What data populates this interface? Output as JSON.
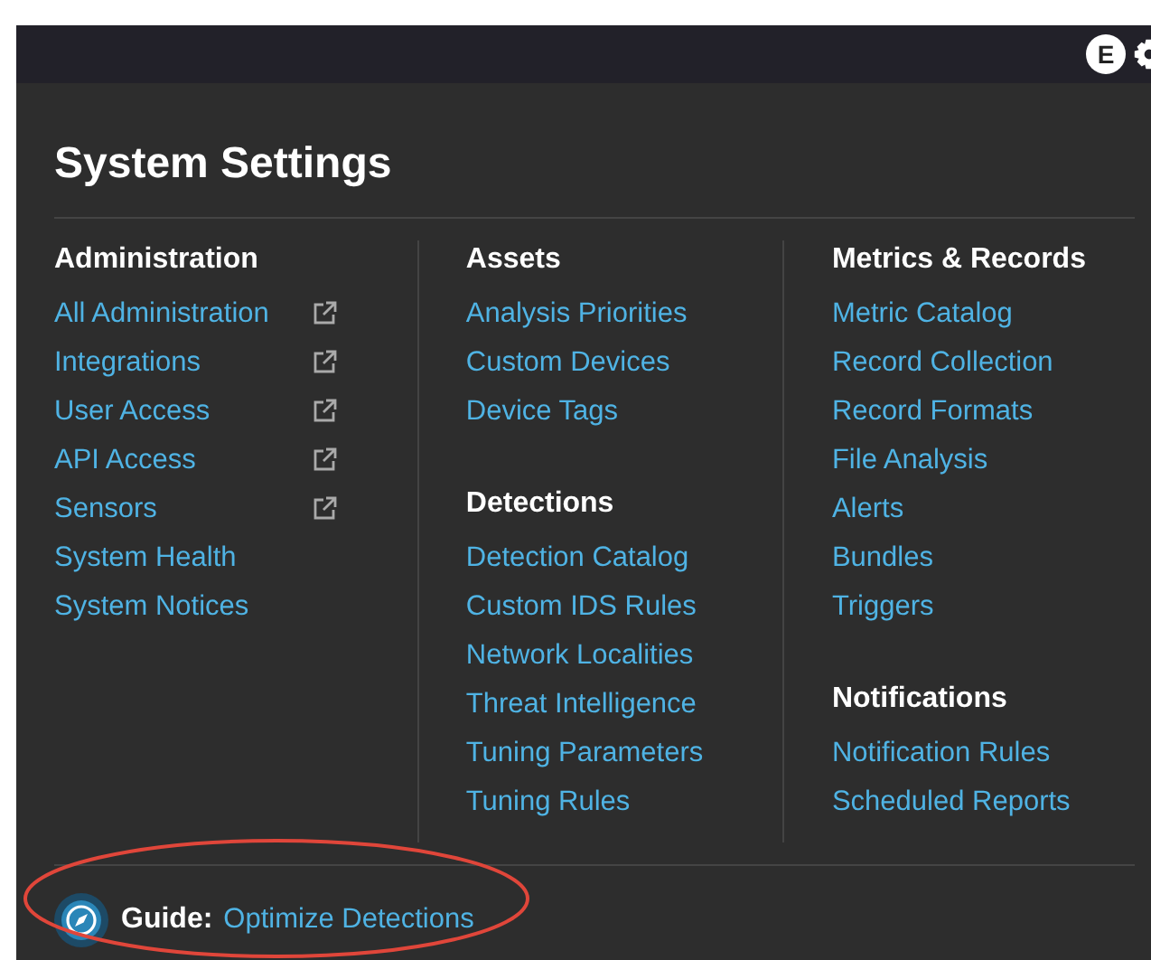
{
  "top_bar": {
    "avatar_letter": "E"
  },
  "title": "System Settings",
  "columns": [
    {
      "sections": [
        {
          "heading": "Administration",
          "items": [
            {
              "label": "All Administration",
              "external": true
            },
            {
              "label": "Integrations",
              "external": true
            },
            {
              "label": "User Access",
              "external": true
            },
            {
              "label": "API Access",
              "external": true
            },
            {
              "label": "Sensors",
              "external": true
            },
            {
              "label": "System Health",
              "external": false
            },
            {
              "label": "System Notices",
              "external": false
            }
          ]
        }
      ]
    },
    {
      "sections": [
        {
          "heading": "Assets",
          "items": [
            {
              "label": "Analysis Priorities",
              "external": false
            },
            {
              "label": "Custom Devices",
              "external": false
            },
            {
              "label": "Device Tags",
              "external": false
            }
          ]
        },
        {
          "heading": "Detections",
          "items": [
            {
              "label": "Detection Catalog",
              "external": false
            },
            {
              "label": "Custom IDS Rules",
              "external": false
            },
            {
              "label": "Network Localities",
              "external": false
            },
            {
              "label": "Threat Intelligence",
              "external": false
            },
            {
              "label": "Tuning Parameters",
              "external": false
            },
            {
              "label": "Tuning Rules",
              "external": false
            }
          ]
        }
      ]
    },
    {
      "sections": [
        {
          "heading": "Metrics & Records",
          "items": [
            {
              "label": "Metric Catalog",
              "external": false
            },
            {
              "label": "Record Collection",
              "external": false
            },
            {
              "label": "Record Formats",
              "external": false
            },
            {
              "label": "File Analysis",
              "external": false
            },
            {
              "label": "Alerts",
              "external": false
            },
            {
              "label": "Bundles",
              "external": false
            },
            {
              "label": "Triggers",
              "external": false
            }
          ]
        },
        {
          "heading": "Notifications",
          "items": [
            {
              "label": "Notification Rules",
              "external": false
            },
            {
              "label": "Scheduled Reports",
              "external": false
            }
          ]
        }
      ]
    }
  ],
  "guide": {
    "label": "Guide:",
    "link": "Optimize Detections",
    "highlighted": true
  }
}
